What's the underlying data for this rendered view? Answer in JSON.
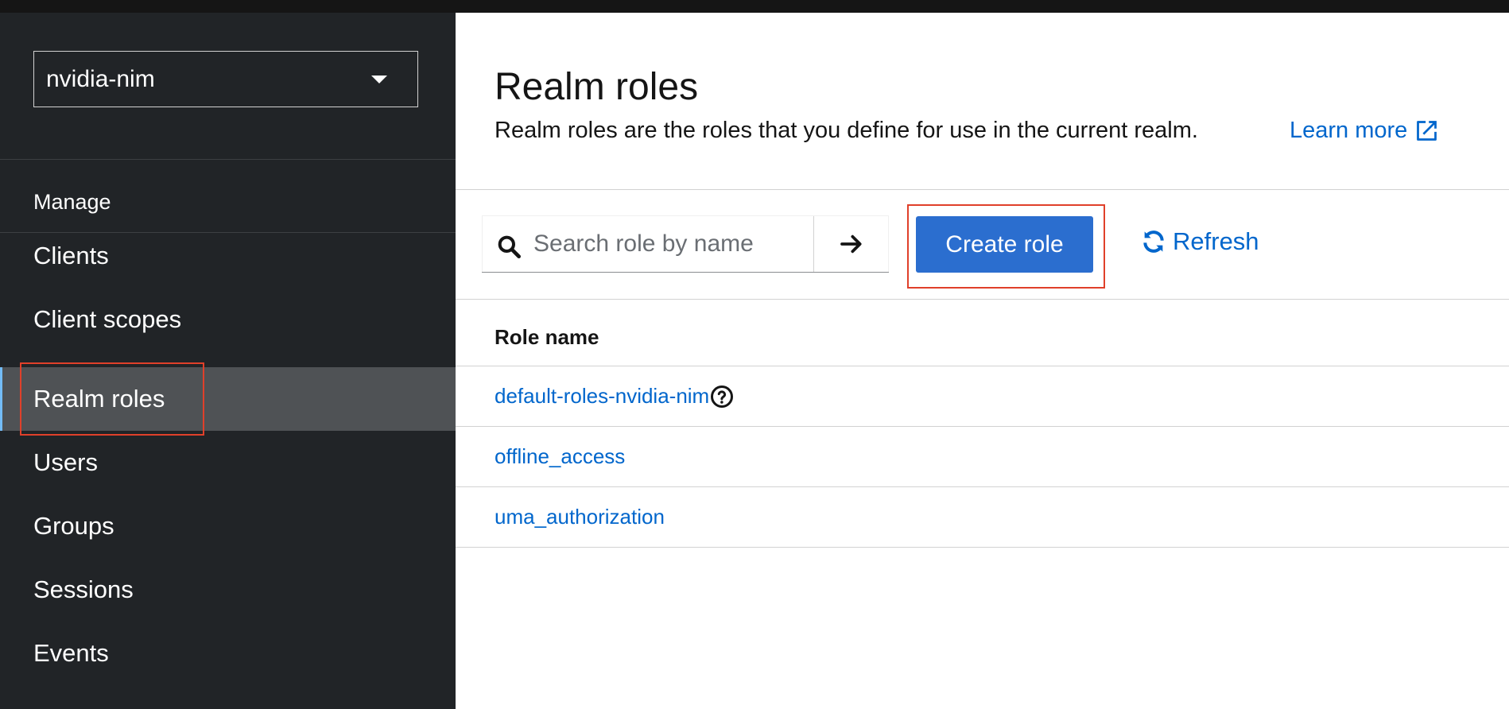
{
  "sidebar": {
    "realm_selector": {
      "value": "nvidia-nim"
    },
    "section_label": "Manage",
    "items": [
      {
        "label": "Clients"
      },
      {
        "label": "Client scopes"
      },
      {
        "label": "Realm roles",
        "active": true
      },
      {
        "label": "Users"
      },
      {
        "label": "Groups"
      },
      {
        "label": "Sessions"
      },
      {
        "label": "Events"
      }
    ]
  },
  "header": {
    "title": "Realm roles",
    "description": "Realm roles are the roles that you define for use in the current realm.",
    "learn_more": "Learn more"
  },
  "toolbar": {
    "search_placeholder": "Search role by name",
    "create_label": "Create role",
    "refresh_label": "Refresh"
  },
  "table": {
    "columns": [
      "Role name"
    ],
    "rows": [
      {
        "name": "default-roles-nvidia-nim",
        "help_icon": "question-circle-icon"
      },
      {
        "name": "offline_access"
      },
      {
        "name": "uma_authorization"
      }
    ]
  },
  "colors": {
    "sidebar_bg": "#212427",
    "active_item_bg": "#4f5255",
    "primary": "#2b6ecf",
    "link": "#0066cc",
    "highlight": "#e0402a"
  }
}
